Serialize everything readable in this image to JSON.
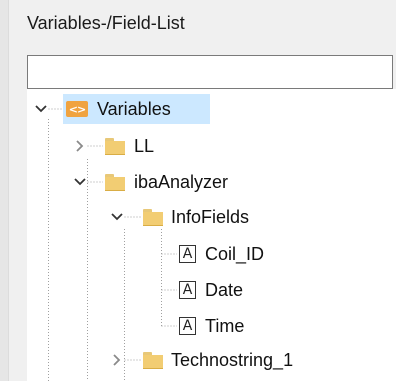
{
  "panel": {
    "title": "Variables-/Field-List"
  },
  "search": {
    "value": "",
    "placeholder": ""
  },
  "tree": {
    "root": {
      "label": "Variables",
      "icon": "variables-icon",
      "expanded": true,
      "selected": true
    },
    "ll": {
      "label": "LL",
      "icon": "folder-icon",
      "expanded": false
    },
    "ibaanalyzer": {
      "label": "ibaAnalyzer",
      "icon": "folder-icon",
      "expanded": true
    },
    "infofields": {
      "label": "InfoFields",
      "icon": "folder-icon",
      "expanded": true
    },
    "fields": [
      {
        "label": "Coil_ID",
        "icon_text": "A"
      },
      {
        "label": "Date",
        "icon_text": "A"
      },
      {
        "label": "Time",
        "icon_text": "A"
      }
    ],
    "technostring": {
      "label": "Technostring_1",
      "icon": "folder-icon",
      "expanded": false
    }
  },
  "colors": {
    "selection": "#cce8ff",
    "folder": "#f2cd73",
    "variables_icon": "#f0a340"
  }
}
